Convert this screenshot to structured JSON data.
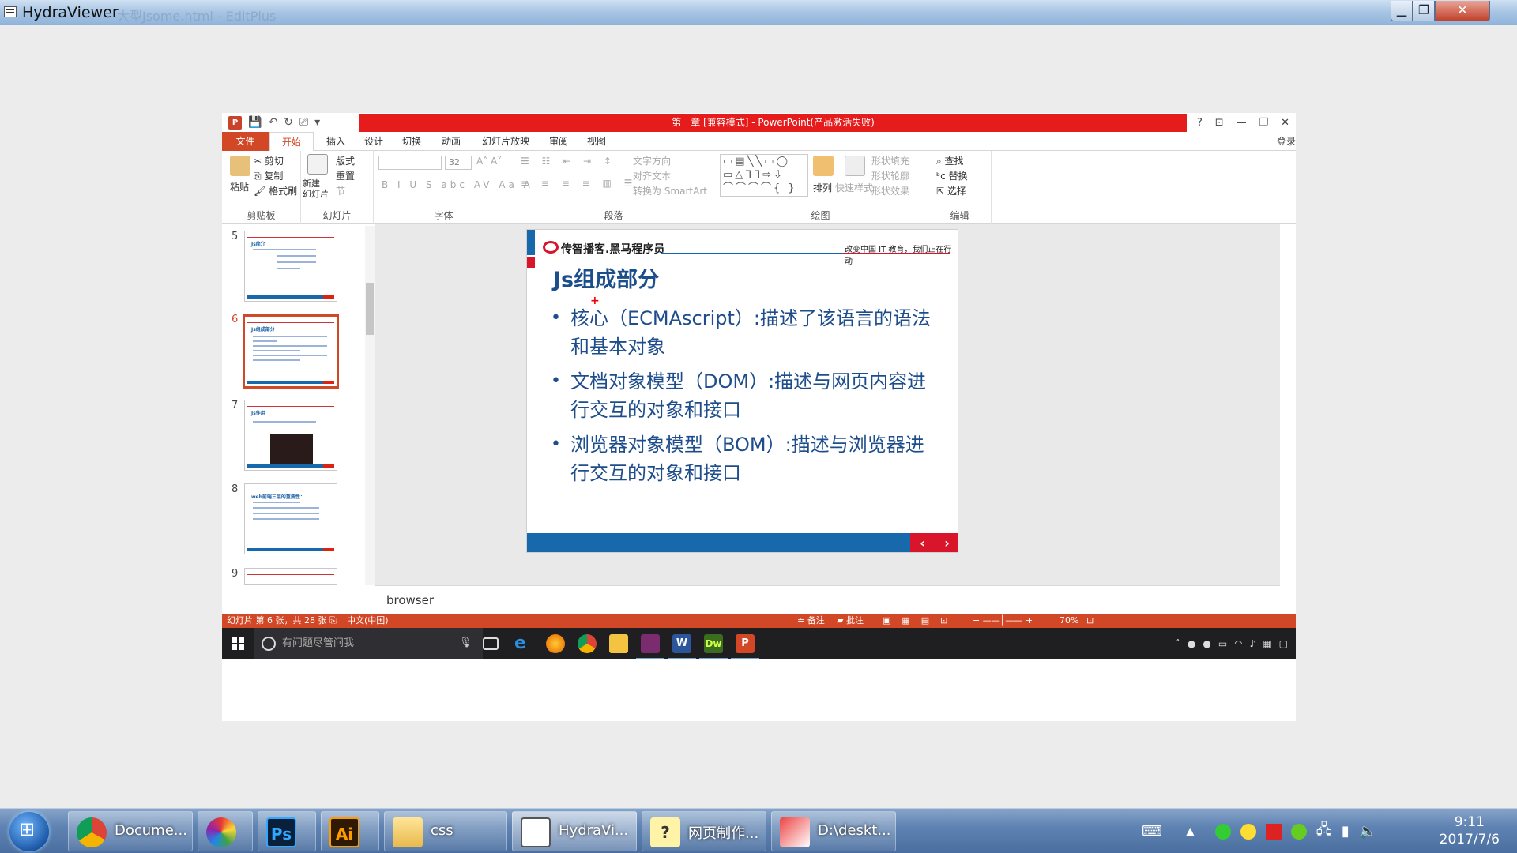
{
  "outer_window": {
    "title": "HydraViewer",
    "ghost_title": "大型Jsome.html - EditPlus",
    "min_icon": "minimize-icon",
    "max_icon": "maximize-icon",
    "close_icon": "close-icon"
  },
  "ppt": {
    "title": "第一章 [兼容模式] -  PowerPoint(产品激活失败)",
    "title_controls": [
      "?",
      "⊡",
      "—",
      "❐",
      "✕"
    ],
    "tabs": [
      "文件",
      "开始",
      "插入",
      "设计",
      "切换",
      "动画",
      "幻灯片放映",
      "审阅",
      "视图"
    ],
    "login": "登录",
    "ribbon": {
      "clipboard": {
        "paste": "粘贴",
        "cut": "剪切",
        "copy": "复制",
        "format_painter": "格式刷",
        "label": "剪贴板"
      },
      "slides": {
        "new_slide": "新建\n幻灯片",
        "layout": "版式",
        "reset": "重置",
        "section": "节",
        "label": "幻灯片"
      },
      "font": {
        "font_size": "32",
        "label": "字体"
      },
      "paragraph": {
        "text_direction": "文字方向",
        "align_text": "对齐文本",
        "smartart": "转换为 SmartArt",
        "label": "段落"
      },
      "drawing": {
        "arrange": "排列",
        "quick_styles": "快速样式",
        "shape_fill": "形状填充",
        "shape_outline": "形状轮廓",
        "shape_effects": "形状效果",
        "label": "绘图"
      },
      "editing": {
        "find": "查找",
        "replace": "替换",
        "select": "选择",
        "label": "编辑"
      }
    },
    "thumbnails": [
      {
        "num": "5",
        "title": "Js简介",
        "active": false
      },
      {
        "num": "6",
        "title": "Js组成部分",
        "active": true
      },
      {
        "num": "7",
        "title": "Js作用",
        "active": false
      },
      {
        "num": "8",
        "title": "web前端三层的重要性：",
        "active": false
      },
      {
        "num": "9",
        "title": "",
        "active": false
      }
    ],
    "slide": {
      "brand": "传智播客.黑马程序员",
      "slogan": "改变中国 IT 教育，我们正在行动",
      "title": "Js组成部分",
      "bullets": [
        "核心（ECMAscript）:描述了该语言的语法和基本对象",
        "文档对象模型（DOM）:描述与网页内容进行交互的对象和接口",
        "浏览器对象模型（BOM）:描述与浏览器进行交互的对象和接口"
      ],
      "nav_prev": "‹",
      "nav_next": "›"
    },
    "notes": "browser",
    "status": {
      "slide_info": "幻灯片 第 6 张，共 28 张",
      "language": "中文(中国)",
      "notes_btn": "备注",
      "comments_btn": "批注",
      "zoom": "70%"
    }
  },
  "win10_taskbar": {
    "search_placeholder": "有问题尽管问我"
  },
  "w7_taskbar": {
    "items": [
      {
        "label": "Docume...",
        "icon": "chrome-icon"
      },
      {
        "label": "",
        "icon": "picasa-icon"
      },
      {
        "label": "",
        "icon": "photoshop-icon",
        "glyph": "Ps"
      },
      {
        "label": "",
        "icon": "illustrator-icon",
        "glyph": "Ai"
      },
      {
        "label": "css",
        "icon": "folder-icon"
      },
      {
        "label": "HydraVi...",
        "icon": "hydraviewer-icon"
      },
      {
        "label": "网页制作...",
        "icon": "help-icon"
      },
      {
        "label": "D:\\deskt...",
        "icon": "editplus-icon"
      }
    ],
    "clock_time": "9:11",
    "clock_date": "2017/7/6"
  }
}
